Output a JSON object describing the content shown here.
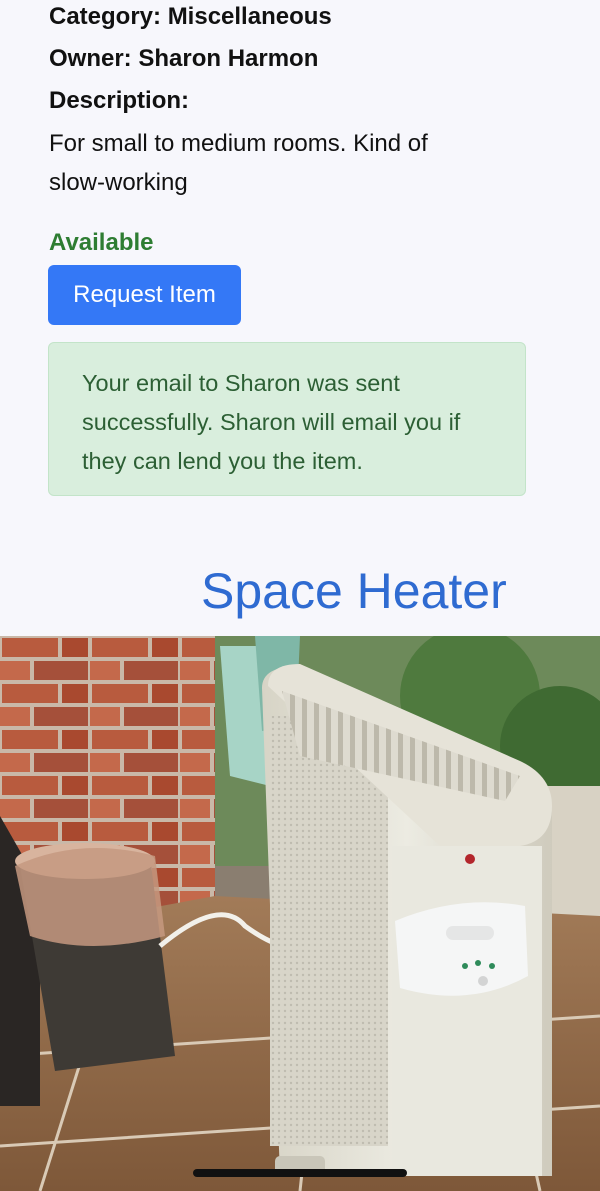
{
  "item": {
    "category_line": "Category: Miscellaneous",
    "owner_line": "Owner: Sharon Harmon",
    "description_label": "Description:",
    "description": "For small to medium rooms. Kind of slow-working",
    "status": "Available",
    "request_button_label": "Request Item",
    "success_message": "Your email to Sharon was sent successfully. Sharon will email you if they can lend you the item.",
    "title": "Space Heater"
  },
  "colors": {
    "background": "#f7f7fc",
    "status_green": "#2e7d32",
    "button_blue": "#3478f6",
    "alert_bg": "#d9eedd",
    "alert_text": "#2c5f34",
    "title_blue": "#2f6bd1"
  },
  "photo": {
    "subject": "space-heater-photo"
  }
}
